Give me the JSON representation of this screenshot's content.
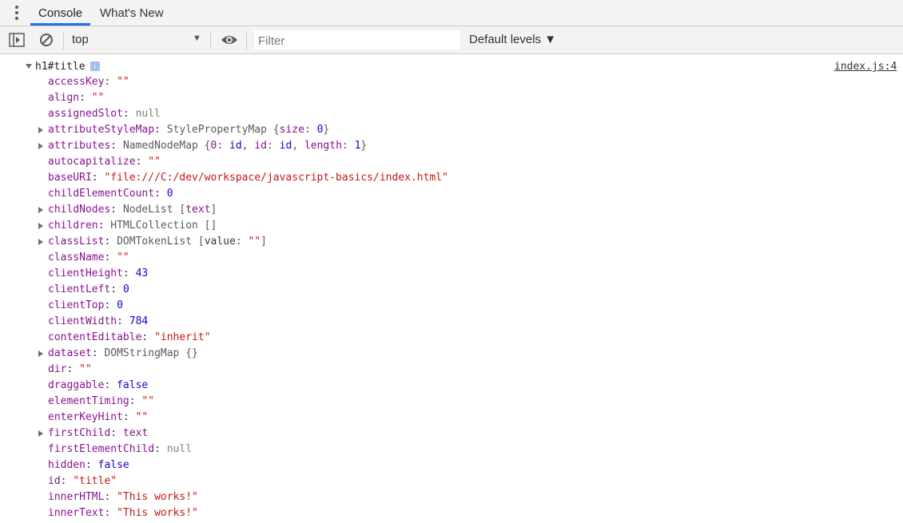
{
  "tabs": [
    {
      "label": "Console",
      "active": true
    },
    {
      "label": "What's New",
      "active": false
    }
  ],
  "toolbar": {
    "context": "top",
    "filter_placeholder": "Filter",
    "levels_label": "Default levels ▼"
  },
  "log": {
    "header": "h1#title",
    "info_badge": "i",
    "source": "index.js:4"
  },
  "properties": [
    {
      "key": "accessKey",
      "expandable": false,
      "parts": [
        {
          "t": "s",
          "v": "\"\""
        }
      ]
    },
    {
      "key": "align",
      "expandable": false,
      "parts": [
        {
          "t": "s",
          "v": "\"\""
        }
      ]
    },
    {
      "key": "assignedSlot",
      "expandable": false,
      "parts": [
        {
          "t": "nl",
          "v": "null"
        }
      ]
    },
    {
      "key": "attributeStyleMap",
      "expandable": true,
      "parts": [
        {
          "t": "o",
          "v": "StylePropertyMap {"
        },
        {
          "t": "k",
          "v": "size"
        },
        {
          "t": "o",
          "v": ": "
        },
        {
          "t": "n",
          "v": "0"
        },
        {
          "t": "o",
          "v": "}"
        }
      ]
    },
    {
      "key": "attributes",
      "expandable": true,
      "parts": [
        {
          "t": "o",
          "v": "NamedNodeMap {"
        },
        {
          "t": "k",
          "v": "0"
        },
        {
          "t": "o",
          "v": ": "
        },
        {
          "t": "n",
          "v": "id"
        },
        {
          "t": "o",
          "v": ", "
        },
        {
          "t": "k",
          "v": "id"
        },
        {
          "t": "o",
          "v": ": "
        },
        {
          "t": "n",
          "v": "id"
        },
        {
          "t": "o",
          "v": ", "
        },
        {
          "t": "k",
          "v": "length"
        },
        {
          "t": "o",
          "v": ": "
        },
        {
          "t": "n",
          "v": "1"
        },
        {
          "t": "o",
          "v": "}"
        }
      ]
    },
    {
      "key": "autocapitalize",
      "expandable": false,
      "parts": [
        {
          "t": "s",
          "v": "\"\""
        }
      ]
    },
    {
      "key": "baseURI",
      "expandable": false,
      "parts": [
        {
          "t": "s",
          "v": "\"file:///C:/dev/workspace/javascript-basics/index.html\""
        }
      ]
    },
    {
      "key": "childElementCount",
      "expandable": false,
      "parts": [
        {
          "t": "n",
          "v": "0"
        }
      ]
    },
    {
      "key": "childNodes",
      "expandable": true,
      "parts": [
        {
          "t": "o",
          "v": "NodeList ["
        },
        {
          "t": "k",
          "v": "text"
        },
        {
          "t": "o",
          "v": "]"
        }
      ]
    },
    {
      "key": "children",
      "expandable": true,
      "parts": [
        {
          "t": "o",
          "v": "HTMLCollection []"
        }
      ]
    },
    {
      "key": "classList",
      "expandable": true,
      "parts": [
        {
          "t": "o",
          "v": "DOMTokenList ["
        },
        {
          "t": "p",
          "v": "value"
        },
        {
          "t": "o",
          "v": ": "
        },
        {
          "t": "s",
          "v": "\"\""
        },
        {
          "t": "o",
          "v": "]"
        }
      ]
    },
    {
      "key": "className",
      "expandable": false,
      "parts": [
        {
          "t": "s",
          "v": "\"\""
        }
      ]
    },
    {
      "key": "clientHeight",
      "expandable": false,
      "parts": [
        {
          "t": "n",
          "v": "43"
        }
      ]
    },
    {
      "key": "clientLeft",
      "expandable": false,
      "parts": [
        {
          "t": "n",
          "v": "0"
        }
      ]
    },
    {
      "key": "clientTop",
      "expandable": false,
      "parts": [
        {
          "t": "n",
          "v": "0"
        }
      ]
    },
    {
      "key": "clientWidth",
      "expandable": false,
      "parts": [
        {
          "t": "n",
          "v": "784"
        }
      ]
    },
    {
      "key": "contentEditable",
      "expandable": false,
      "parts": [
        {
          "t": "s",
          "v": "\"inherit\""
        }
      ]
    },
    {
      "key": "dataset",
      "expandable": true,
      "parts": [
        {
          "t": "o",
          "v": "DOMStringMap {}"
        }
      ]
    },
    {
      "key": "dir",
      "expandable": false,
      "parts": [
        {
          "t": "s",
          "v": "\"\""
        }
      ]
    },
    {
      "key": "draggable",
      "expandable": false,
      "parts": [
        {
          "t": "b",
          "v": "false"
        }
      ]
    },
    {
      "key": "elementTiming",
      "expandable": false,
      "parts": [
        {
          "t": "s",
          "v": "\"\""
        }
      ]
    },
    {
      "key": "enterKeyHint",
      "expandable": false,
      "parts": [
        {
          "t": "s",
          "v": "\"\""
        }
      ]
    },
    {
      "key": "firstChild",
      "expandable": true,
      "parts": [
        {
          "t": "k",
          "v": "text"
        }
      ]
    },
    {
      "key": "firstElementChild",
      "expandable": false,
      "parts": [
        {
          "t": "nl",
          "v": "null"
        }
      ]
    },
    {
      "key": "hidden",
      "expandable": false,
      "parts": [
        {
          "t": "b",
          "v": "false"
        }
      ]
    },
    {
      "key": "id",
      "expandable": false,
      "parts": [
        {
          "t": "s",
          "v": "\"title\""
        }
      ]
    },
    {
      "key": "innerHTML",
      "expandable": false,
      "parts": [
        {
          "t": "s",
          "v": "\"This works!\""
        }
      ]
    },
    {
      "key": "innerText",
      "expandable": false,
      "parts": [
        {
          "t": "s",
          "v": "\"This works!\""
        }
      ]
    }
  ],
  "colors": {
    "accent": "#1a73e8",
    "property_key": "#881391",
    "string": "#c41a16",
    "number": "#1c00cf",
    "null": "#808080"
  }
}
